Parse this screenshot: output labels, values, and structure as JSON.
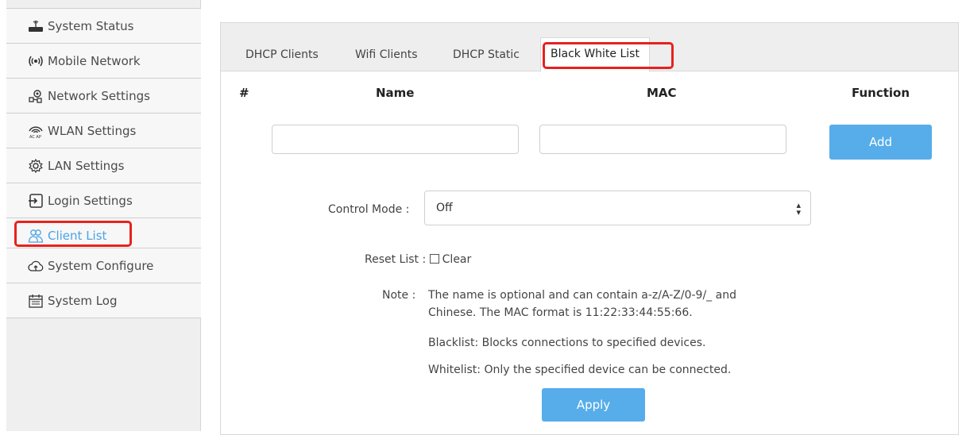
{
  "sidebar": {
    "items": [
      {
        "label": "System Status",
        "icon": "router-icon"
      },
      {
        "label": "Mobile Network",
        "icon": "signal-icon"
      },
      {
        "label": "Network Settings",
        "icon": "network-icon"
      },
      {
        "label": "WLAN Settings",
        "icon": "wifi-icon"
      },
      {
        "label": "LAN Settings",
        "icon": "gear-icon"
      },
      {
        "label": "Login Settings",
        "icon": "login-icon"
      },
      {
        "label": "Client List",
        "icon": "users-icon"
      },
      {
        "label": "System Configure",
        "icon": "cloud-upload-icon"
      },
      {
        "label": "System Log",
        "icon": "calendar-icon"
      }
    ],
    "active": "Client List"
  },
  "tabs": [
    {
      "label": "DHCP Clients"
    },
    {
      "label": "Wifi Clients"
    },
    {
      "label": "DHCP Static"
    },
    {
      "label": "Black White List"
    }
  ],
  "table": {
    "col_index": "#",
    "col_name": "Name",
    "col_mac": "MAC",
    "col_function": "Function"
  },
  "inputs": {
    "name_value": "",
    "mac_value": ""
  },
  "buttons": {
    "add": "Add",
    "apply": "Apply"
  },
  "control_mode": {
    "label": "Control Mode :",
    "value": "Off"
  },
  "reset": {
    "label": "Reset List :",
    "option": "Clear"
  },
  "note": {
    "label": "Note :",
    "line1": "The name is optional and can contain a-z/A-Z/0-9/_ and",
    "line2": "Chinese. The MAC format is 11:22:33:44:55:66.",
    "line3": "Blacklist: Blocks connections to specified devices.",
    "line4": "Whitelist: Only the specified device can be connected."
  },
  "colors": {
    "accent": "#56adea",
    "highlight": "#e8211d",
    "active_text": "#4aa3e6"
  }
}
